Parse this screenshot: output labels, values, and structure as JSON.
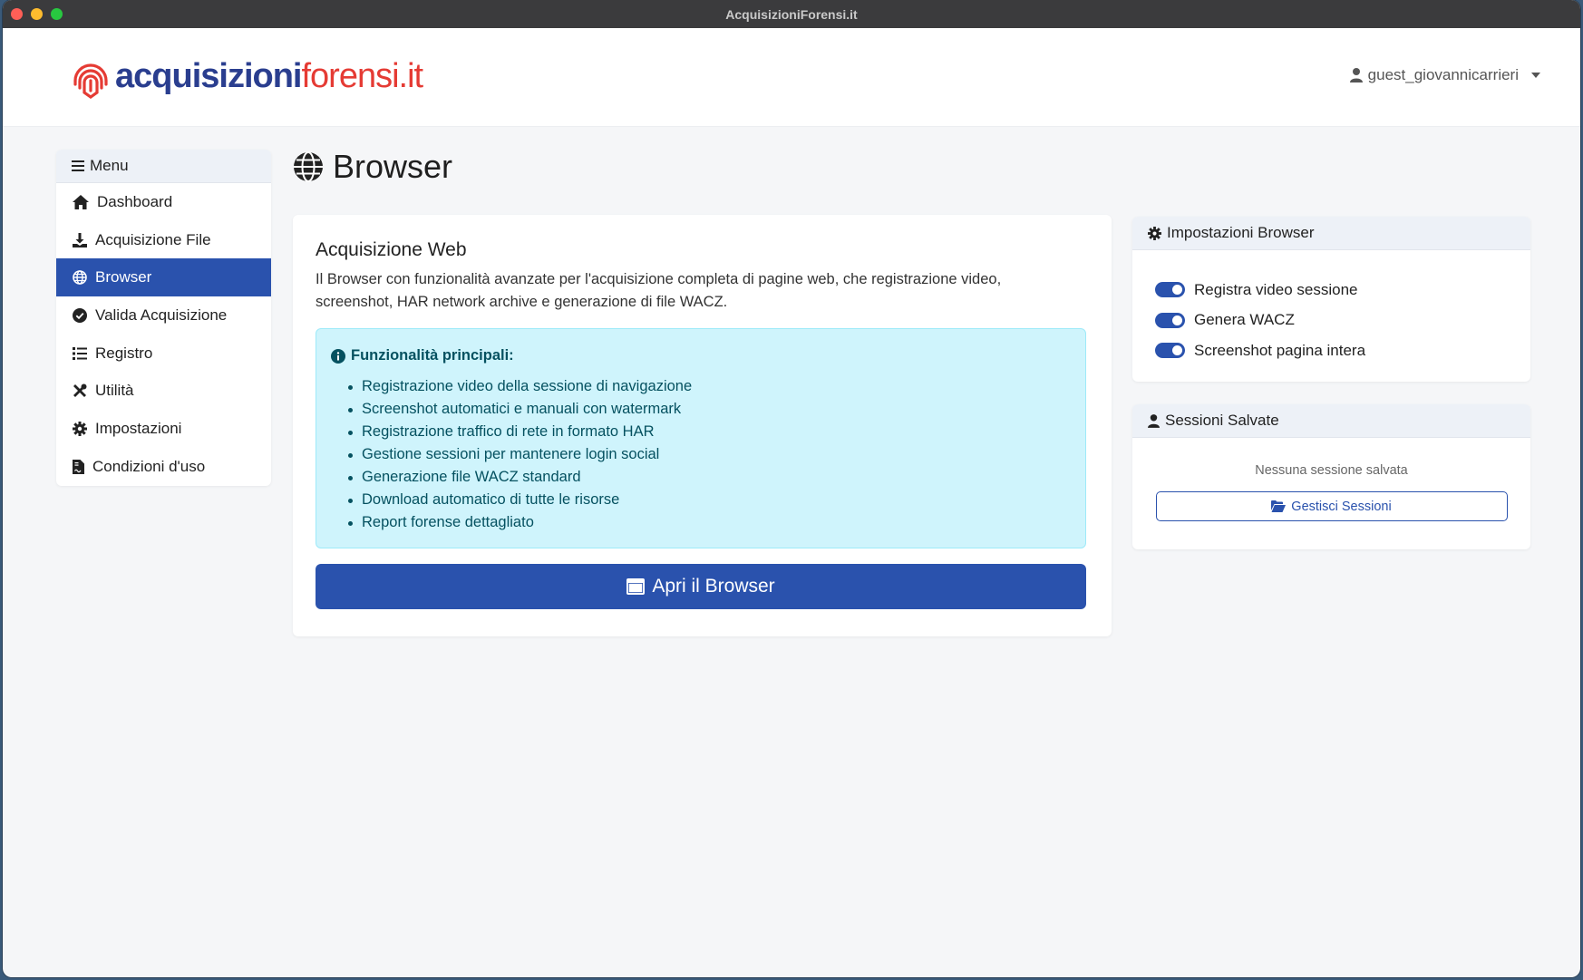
{
  "window": {
    "title": "AcquisizioniForensi.it"
  },
  "brand": {
    "part1": "acquisizioni",
    "part2": "forensi.it"
  },
  "user": {
    "name": "guest_giovannicarrieri"
  },
  "sidebar": {
    "title": "Menu",
    "items": [
      {
        "label": "Dashboard",
        "icon": "home-icon",
        "active": false
      },
      {
        "label": "Acquisizione File",
        "icon": "download-icon",
        "active": false
      },
      {
        "label": "Browser",
        "icon": "globe-icon",
        "active": true
      },
      {
        "label": "Valida Acquisizione",
        "icon": "check-circle-icon",
        "active": false
      },
      {
        "label": "Registro",
        "icon": "list-icon",
        "active": false
      },
      {
        "label": "Utilità",
        "icon": "tools-icon",
        "active": false
      },
      {
        "label": "Impostazioni",
        "icon": "gear-icon",
        "active": false
      },
      {
        "label": "Condizioni d'uso",
        "icon": "file-contract-icon",
        "active": false
      }
    ]
  },
  "page": {
    "title": "Browser"
  },
  "main": {
    "heading": "Acquisizione Web",
    "description": "Il Browser con funzionalità avanzate per l'acquisizione completa di pagine web, che registrazione video, screenshot, HAR network archive e generazione di file WACZ.",
    "features_title": "Funzionalità principali:",
    "features": [
      "Registrazione video della sessione di navigazione",
      "Screenshot automatici e manuali con watermark",
      "Registrazione traffico di rete in formato HAR",
      "Gestione sessioni per mantenere login social",
      "Generazione file WACZ standard",
      "Download automatico di tutte le risorse",
      "Report forense dettagliato"
    ],
    "open_button": "Apri il Browser"
  },
  "settings": {
    "title": "Impostazioni Browser",
    "toggles": [
      {
        "label": "Registra video sessione",
        "on": true
      },
      {
        "label": "Genera WACZ",
        "on": true
      },
      {
        "label": "Screenshot pagina intera",
        "on": true
      }
    ]
  },
  "sessions": {
    "title": "Sessioni Salvate",
    "empty_text": "Nessuna sessione salvata",
    "manage_button": "Gestisci Sessioni"
  },
  "colors": {
    "primary": "#2a52ad",
    "brand_blue": "#2a3e8f",
    "brand_red": "#e53b34",
    "info_bg": "#cff4fc",
    "info_text": "#055160"
  }
}
